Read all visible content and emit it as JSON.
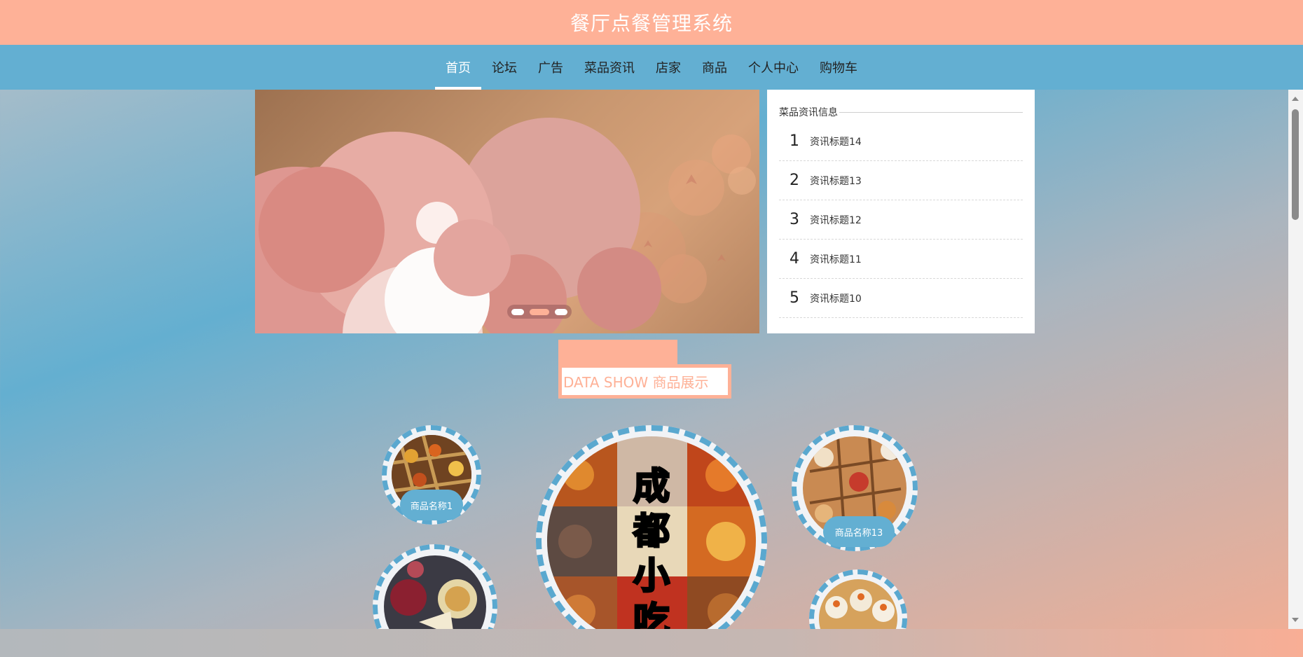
{
  "header": {
    "title": "餐厅点餐管理系统"
  },
  "nav": {
    "items": [
      {
        "label": "首页",
        "active": true
      },
      {
        "label": "论坛",
        "active": false
      },
      {
        "label": "广告",
        "active": false
      },
      {
        "label": "菜品资讯",
        "active": false
      },
      {
        "label": "店家",
        "active": false
      },
      {
        "label": "商品",
        "active": false
      },
      {
        "label": "个人中心",
        "active": false
      },
      {
        "label": "购物车",
        "active": false
      }
    ]
  },
  "banner": {
    "slide_count": 3,
    "active_slide": 2
  },
  "news": {
    "heading": "菜品资讯信息",
    "items": [
      {
        "num": "1",
        "title": "资讯标题14"
      },
      {
        "num": "2",
        "title": "资讯标题13"
      },
      {
        "num": "3",
        "title": "资讯标题12"
      },
      {
        "num": "4",
        "title": "资讯标题11"
      },
      {
        "num": "5",
        "title": "资讯标题10"
      }
    ]
  },
  "showcase": {
    "title": "DATA SHOW 商品展示",
    "featured_text": "成都小吃",
    "products": [
      {
        "name": "商品名称1"
      },
      {
        "name": "商品名称13"
      }
    ]
  },
  "colors": {
    "header": "#feb197",
    "nav": "#63afd2",
    "accent": "#feb197",
    "label": "#63afd2"
  }
}
